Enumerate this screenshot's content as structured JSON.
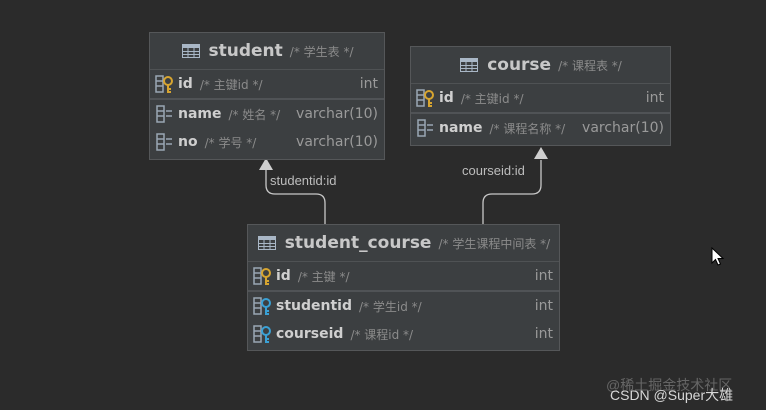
{
  "tables": {
    "student": {
      "name": "student",
      "comment": "/* 学生表 */",
      "columns": [
        {
          "name": "id",
          "comment": "/* 主键id */",
          "type": "int"
        },
        {
          "name": "name",
          "comment": "/* 姓名 */",
          "type": "varchar(10)"
        },
        {
          "name": "no",
          "comment": "/* 学号 */",
          "type": "varchar(10)"
        }
      ]
    },
    "course": {
      "name": "course",
      "comment": "/* 课程表 */",
      "columns": [
        {
          "name": "id",
          "comment": "/* 主键id */",
          "type": "int"
        },
        {
          "name": "name",
          "comment": "/* 课程名称 */",
          "type": "varchar(10)"
        }
      ]
    },
    "student_course": {
      "name": "student_course",
      "comment": "/* 学生课程中间表 */",
      "columns": [
        {
          "name": "id",
          "comment": "/* 主键 */",
          "type": "int"
        },
        {
          "name": "studentid",
          "comment": "/* 学生id */",
          "type": "int"
        },
        {
          "name": "courseid",
          "comment": "/* 课程id */",
          "type": "int"
        }
      ]
    }
  },
  "relations": [
    {
      "label": "studentid:id"
    },
    {
      "label": "courseid:id"
    }
  ],
  "watermark": {
    "line1": "@稀土掘金技术社区",
    "line2": "CSDN @Super大雄"
  },
  "icons": {
    "table": "table-icon",
    "primary_key": "primary-key-icon",
    "foreign_key": "foreign-key-icon",
    "column": "column-icon",
    "cursor": "mouse-cursor-icon"
  },
  "colors": {
    "background": "#2b2b2b",
    "table_bg": "#3c3f41",
    "key_gold": "#d7a530",
    "key_blue": "#3aa1d6"
  }
}
